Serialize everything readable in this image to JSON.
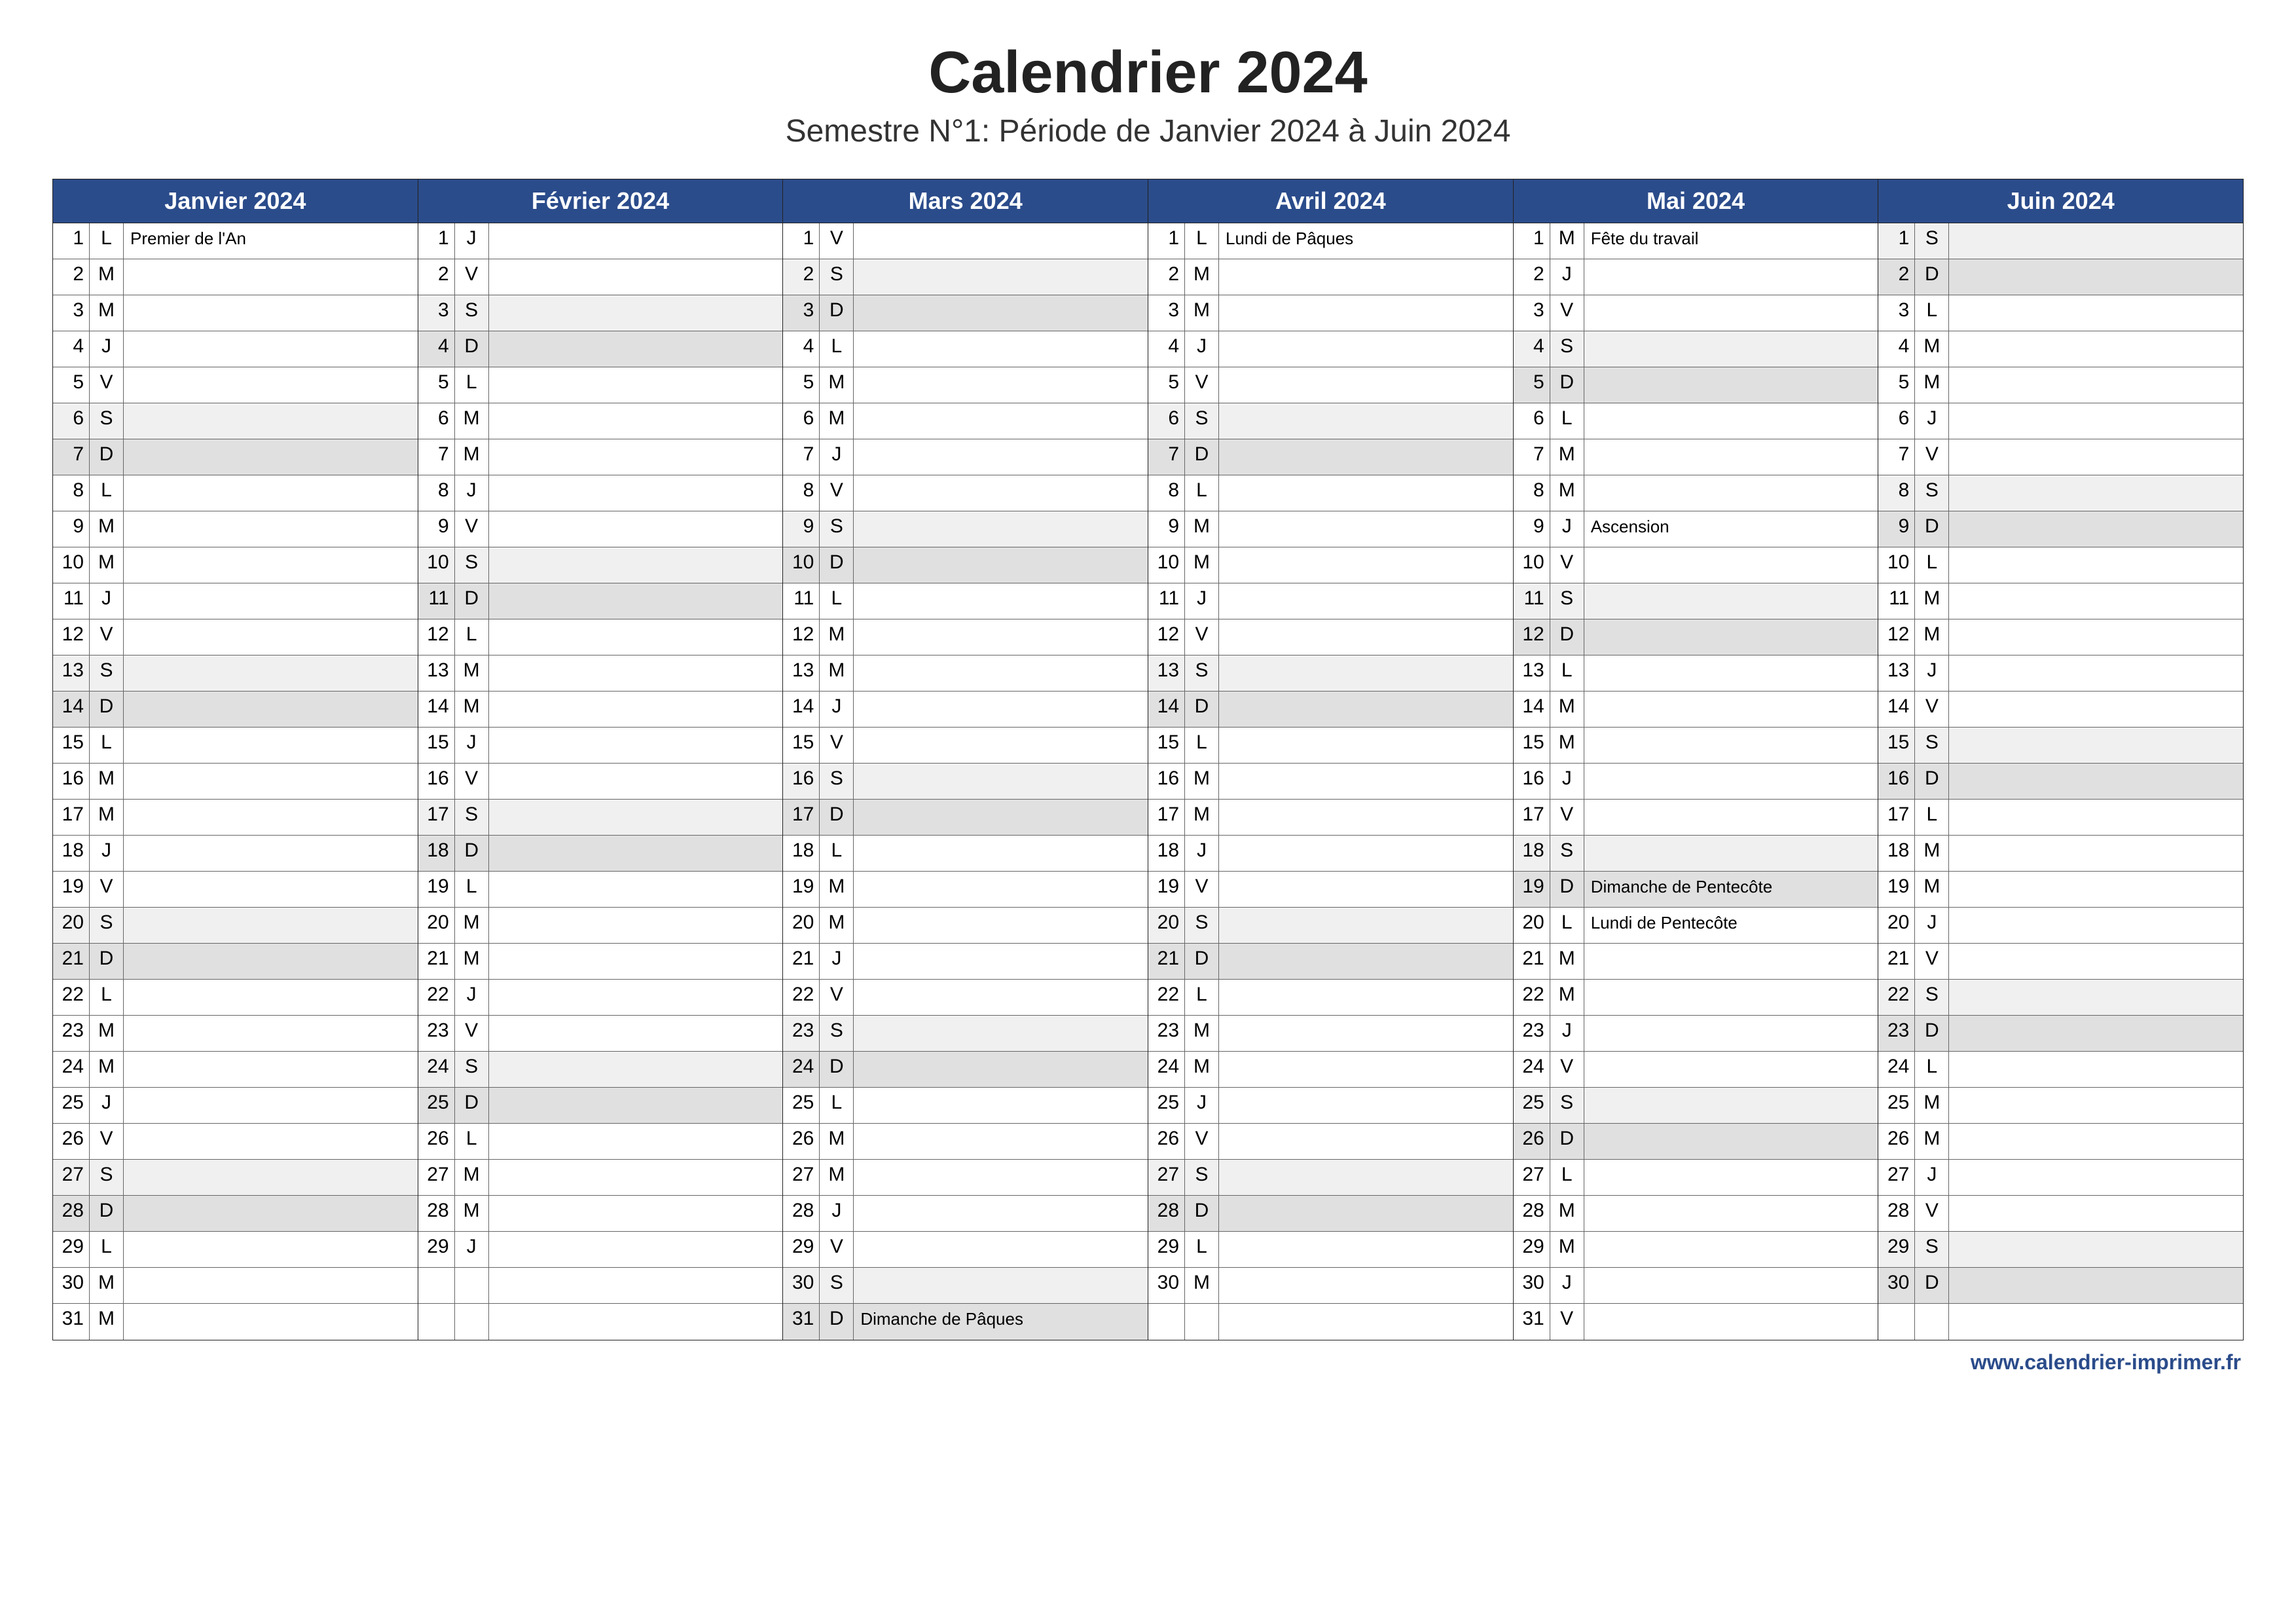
{
  "title": "Calendrier 2024",
  "subtitle": "Semestre N°1: Période de Janvier 2024 à Juin 2024",
  "footer": "www.calendrier-imprimer.fr",
  "colors": {
    "header_bg": "#2b4c8b",
    "weekend_bg": "#e0e0e0",
    "saturday_bg": "#f0f0f0"
  },
  "weekday_letters": {
    "mon": "L",
    "tue": "M",
    "wed": "M",
    "thu": "J",
    "fri": "V",
    "sat": "S",
    "sun": "D"
  },
  "months": [
    {
      "name": "Janvier 2024",
      "days": [
        {
          "n": 1,
          "w": "L",
          "e": "Premier de l'An"
        },
        {
          "n": 2,
          "w": "M"
        },
        {
          "n": 3,
          "w": "M"
        },
        {
          "n": 4,
          "w": "J"
        },
        {
          "n": 5,
          "w": "V"
        },
        {
          "n": 6,
          "w": "S"
        },
        {
          "n": 7,
          "w": "D"
        },
        {
          "n": 8,
          "w": "L"
        },
        {
          "n": 9,
          "w": "M"
        },
        {
          "n": 10,
          "w": "M"
        },
        {
          "n": 11,
          "w": "J"
        },
        {
          "n": 12,
          "w": "V"
        },
        {
          "n": 13,
          "w": "S"
        },
        {
          "n": 14,
          "w": "D"
        },
        {
          "n": 15,
          "w": "L"
        },
        {
          "n": 16,
          "w": "M"
        },
        {
          "n": 17,
          "w": "M"
        },
        {
          "n": 18,
          "w": "J"
        },
        {
          "n": 19,
          "w": "V"
        },
        {
          "n": 20,
          "w": "S"
        },
        {
          "n": 21,
          "w": "D"
        },
        {
          "n": 22,
          "w": "L"
        },
        {
          "n": 23,
          "w": "M"
        },
        {
          "n": 24,
          "w": "M"
        },
        {
          "n": 25,
          "w": "J"
        },
        {
          "n": 26,
          "w": "V"
        },
        {
          "n": 27,
          "w": "S"
        },
        {
          "n": 28,
          "w": "D"
        },
        {
          "n": 29,
          "w": "L"
        },
        {
          "n": 30,
          "w": "M"
        },
        {
          "n": 31,
          "w": "M"
        }
      ]
    },
    {
      "name": "Février 2024",
      "days": [
        {
          "n": 1,
          "w": "J"
        },
        {
          "n": 2,
          "w": "V"
        },
        {
          "n": 3,
          "w": "S"
        },
        {
          "n": 4,
          "w": "D"
        },
        {
          "n": 5,
          "w": "L"
        },
        {
          "n": 6,
          "w": "M"
        },
        {
          "n": 7,
          "w": "M"
        },
        {
          "n": 8,
          "w": "J"
        },
        {
          "n": 9,
          "w": "V"
        },
        {
          "n": 10,
          "w": "S"
        },
        {
          "n": 11,
          "w": "D"
        },
        {
          "n": 12,
          "w": "L"
        },
        {
          "n": 13,
          "w": "M"
        },
        {
          "n": 14,
          "w": "M"
        },
        {
          "n": 15,
          "w": "J"
        },
        {
          "n": 16,
          "w": "V"
        },
        {
          "n": 17,
          "w": "S"
        },
        {
          "n": 18,
          "w": "D"
        },
        {
          "n": 19,
          "w": "L"
        },
        {
          "n": 20,
          "w": "M"
        },
        {
          "n": 21,
          "w": "M"
        },
        {
          "n": 22,
          "w": "J"
        },
        {
          "n": 23,
          "w": "V"
        },
        {
          "n": 24,
          "w": "S"
        },
        {
          "n": 25,
          "w": "D"
        },
        {
          "n": 26,
          "w": "L"
        },
        {
          "n": 27,
          "w": "M"
        },
        {
          "n": 28,
          "w": "M"
        },
        {
          "n": 29,
          "w": "J"
        }
      ]
    },
    {
      "name": "Mars 2024",
      "days": [
        {
          "n": 1,
          "w": "V"
        },
        {
          "n": 2,
          "w": "S"
        },
        {
          "n": 3,
          "w": "D"
        },
        {
          "n": 4,
          "w": "L"
        },
        {
          "n": 5,
          "w": "M"
        },
        {
          "n": 6,
          "w": "M"
        },
        {
          "n": 7,
          "w": "J"
        },
        {
          "n": 8,
          "w": "V"
        },
        {
          "n": 9,
          "w": "S"
        },
        {
          "n": 10,
          "w": "D"
        },
        {
          "n": 11,
          "w": "L"
        },
        {
          "n": 12,
          "w": "M"
        },
        {
          "n": 13,
          "w": "M"
        },
        {
          "n": 14,
          "w": "J"
        },
        {
          "n": 15,
          "w": "V"
        },
        {
          "n": 16,
          "w": "S"
        },
        {
          "n": 17,
          "w": "D"
        },
        {
          "n": 18,
          "w": "L"
        },
        {
          "n": 19,
          "w": "M"
        },
        {
          "n": 20,
          "w": "M"
        },
        {
          "n": 21,
          "w": "J"
        },
        {
          "n": 22,
          "w": "V"
        },
        {
          "n": 23,
          "w": "S"
        },
        {
          "n": 24,
          "w": "D"
        },
        {
          "n": 25,
          "w": "L"
        },
        {
          "n": 26,
          "w": "M"
        },
        {
          "n": 27,
          "w": "M"
        },
        {
          "n": 28,
          "w": "J"
        },
        {
          "n": 29,
          "w": "V"
        },
        {
          "n": 30,
          "w": "S"
        },
        {
          "n": 31,
          "w": "D",
          "e": "Dimanche de Pâques"
        }
      ]
    },
    {
      "name": "Avril 2024",
      "days": [
        {
          "n": 1,
          "w": "L",
          "e": "Lundi de Pâques"
        },
        {
          "n": 2,
          "w": "M"
        },
        {
          "n": 3,
          "w": "M"
        },
        {
          "n": 4,
          "w": "J"
        },
        {
          "n": 5,
          "w": "V"
        },
        {
          "n": 6,
          "w": "S"
        },
        {
          "n": 7,
          "w": "D"
        },
        {
          "n": 8,
          "w": "L"
        },
        {
          "n": 9,
          "w": "M"
        },
        {
          "n": 10,
          "w": "M"
        },
        {
          "n": 11,
          "w": "J"
        },
        {
          "n": 12,
          "w": "V"
        },
        {
          "n": 13,
          "w": "S"
        },
        {
          "n": 14,
          "w": "D"
        },
        {
          "n": 15,
          "w": "L"
        },
        {
          "n": 16,
          "w": "M"
        },
        {
          "n": 17,
          "w": "M"
        },
        {
          "n": 18,
          "w": "J"
        },
        {
          "n": 19,
          "w": "V"
        },
        {
          "n": 20,
          "w": "S"
        },
        {
          "n": 21,
          "w": "D"
        },
        {
          "n": 22,
          "w": "L"
        },
        {
          "n": 23,
          "w": "M"
        },
        {
          "n": 24,
          "w": "M"
        },
        {
          "n": 25,
          "w": "J"
        },
        {
          "n": 26,
          "w": "V"
        },
        {
          "n": 27,
          "w": "S"
        },
        {
          "n": 28,
          "w": "D"
        },
        {
          "n": 29,
          "w": "L"
        },
        {
          "n": 30,
          "w": "M"
        }
      ]
    },
    {
      "name": "Mai 2024",
      "days": [
        {
          "n": 1,
          "w": "M",
          "e": "Fête du travail"
        },
        {
          "n": 2,
          "w": "J"
        },
        {
          "n": 3,
          "w": "V"
        },
        {
          "n": 4,
          "w": "S"
        },
        {
          "n": 5,
          "w": "D"
        },
        {
          "n": 6,
          "w": "L"
        },
        {
          "n": 7,
          "w": "M"
        },
        {
          "n": 8,
          "w": "M"
        },
        {
          "n": 9,
          "w": "J",
          "e": "Ascension"
        },
        {
          "n": 10,
          "w": "V"
        },
        {
          "n": 11,
          "w": "S"
        },
        {
          "n": 12,
          "w": "D"
        },
        {
          "n": 13,
          "w": "L"
        },
        {
          "n": 14,
          "w": "M"
        },
        {
          "n": 15,
          "w": "M"
        },
        {
          "n": 16,
          "w": "J"
        },
        {
          "n": 17,
          "w": "V"
        },
        {
          "n": 18,
          "w": "S"
        },
        {
          "n": 19,
          "w": "D",
          "e": "Dimanche de Pentecôte"
        },
        {
          "n": 20,
          "w": "L",
          "e": "Lundi de Pentecôte"
        },
        {
          "n": 21,
          "w": "M"
        },
        {
          "n": 22,
          "w": "M"
        },
        {
          "n": 23,
          "w": "J"
        },
        {
          "n": 24,
          "w": "V"
        },
        {
          "n": 25,
          "w": "S"
        },
        {
          "n": 26,
          "w": "D"
        },
        {
          "n": 27,
          "w": "L"
        },
        {
          "n": 28,
          "w": "M"
        },
        {
          "n": 29,
          "w": "M"
        },
        {
          "n": 30,
          "w": "J"
        },
        {
          "n": 31,
          "w": "V"
        }
      ]
    },
    {
      "name": "Juin 2024",
      "days": [
        {
          "n": 1,
          "w": "S"
        },
        {
          "n": 2,
          "w": "D"
        },
        {
          "n": 3,
          "w": "L"
        },
        {
          "n": 4,
          "w": "M"
        },
        {
          "n": 5,
          "w": "M"
        },
        {
          "n": 6,
          "w": "J"
        },
        {
          "n": 7,
          "w": "V"
        },
        {
          "n": 8,
          "w": "S"
        },
        {
          "n": 9,
          "w": "D"
        },
        {
          "n": 10,
          "w": "L"
        },
        {
          "n": 11,
          "w": "M"
        },
        {
          "n": 12,
          "w": "M"
        },
        {
          "n": 13,
          "w": "J"
        },
        {
          "n": 14,
          "w": "V"
        },
        {
          "n": 15,
          "w": "S"
        },
        {
          "n": 16,
          "w": "D"
        },
        {
          "n": 17,
          "w": "L"
        },
        {
          "n": 18,
          "w": "M"
        },
        {
          "n": 19,
          "w": "M"
        },
        {
          "n": 20,
          "w": "J"
        },
        {
          "n": 21,
          "w": "V"
        },
        {
          "n": 22,
          "w": "S"
        },
        {
          "n": 23,
          "w": "D"
        },
        {
          "n": 24,
          "w": "L"
        },
        {
          "n": 25,
          "w": "M"
        },
        {
          "n": 26,
          "w": "M"
        },
        {
          "n": 27,
          "w": "J"
        },
        {
          "n": 28,
          "w": "V"
        },
        {
          "n": 29,
          "w": "S"
        },
        {
          "n": 30,
          "w": "D"
        }
      ]
    }
  ],
  "max_rows": 31
}
